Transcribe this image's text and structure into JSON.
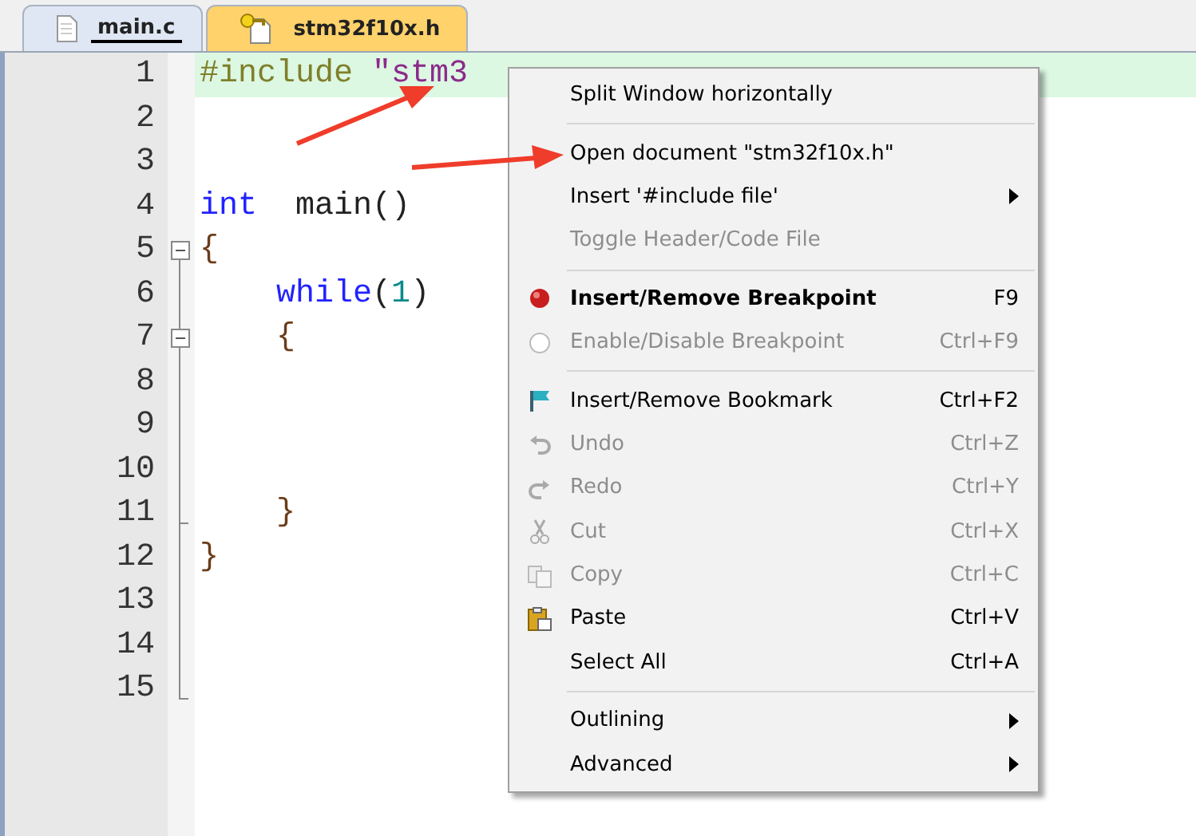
{
  "tabs": [
    {
      "label": "main.c",
      "selected": true
    },
    {
      "label": "stm32f10x.h",
      "selected": false
    }
  ],
  "editor": {
    "lines": [
      {
        "number": "1",
        "current": true,
        "collapsible": false,
        "fold_end": false,
        "tokens": [
          {
            "kind": "preproc",
            "text": "#include "
          },
          {
            "kind": "string",
            "text": "\"stm3"
          }
        ]
      },
      {
        "number": "2",
        "current": false,
        "collapsible": false,
        "fold_end": false
      },
      {
        "number": "3",
        "current": false,
        "collapsible": false,
        "fold_end": false
      },
      {
        "number": "4",
        "current": false,
        "collapsible": false,
        "fold_end": false,
        "tokens": [
          {
            "kind": "keyword",
            "text": "int"
          },
          {
            "kind": "plain",
            "text": "  main()"
          }
        ]
      },
      {
        "number": "5",
        "current": false,
        "collapsible": true,
        "fold_end": false,
        "tokens": [
          {
            "kind": "brace",
            "text": "{"
          }
        ]
      },
      {
        "number": "6",
        "current": false,
        "collapsible": false,
        "fold_end": false,
        "tokens": [
          {
            "kind": "keyword",
            "text": "    while"
          },
          {
            "kind": "plain",
            "text": "("
          },
          {
            "kind": "number",
            "text": "1"
          },
          {
            "kind": "plain",
            "text": ")"
          }
        ]
      },
      {
        "number": "7",
        "current": false,
        "collapsible": true,
        "fold_end": false,
        "tokens": [
          {
            "kind": "brace",
            "text": "    {"
          }
        ]
      },
      {
        "number": "8",
        "current": false,
        "collapsible": false,
        "fold_end": false
      },
      {
        "number": "9",
        "current": false,
        "collapsible": false,
        "fold_end": false
      },
      {
        "number": "10",
        "current": false,
        "collapsible": false,
        "fold_end": false
      },
      {
        "number": "11",
        "current": false,
        "collapsible": false,
        "fold_end": true,
        "tokens": [
          {
            "kind": "brace",
            "text": "    }"
          }
        ]
      },
      {
        "number": "12",
        "current": false,
        "collapsible": false,
        "fold_end": false,
        "tokens": [
          {
            "kind": "brace",
            "text": "}"
          }
        ]
      },
      {
        "number": "13",
        "current": false,
        "collapsible": false,
        "fold_end": false
      },
      {
        "number": "14",
        "current": false,
        "collapsible": false,
        "fold_end": false
      },
      {
        "number": "15",
        "current": false,
        "collapsible": false,
        "fold_end": true
      }
    ]
  },
  "context_menu": {
    "items": [
      {
        "kind": "item",
        "label": "Split Window horizontally",
        "disabled": false,
        "bold": false,
        "submenu": false
      },
      {
        "kind": "separator"
      },
      {
        "kind": "item",
        "label": "Open document \"stm32f10x.h\"",
        "disabled": false,
        "bold": false,
        "submenu": false
      },
      {
        "kind": "item",
        "label": "Insert '#include file'",
        "disabled": false,
        "bold": false,
        "submenu": true
      },
      {
        "kind": "item",
        "label": "Toggle Header/Code File",
        "disabled": true,
        "bold": false,
        "submenu": false
      },
      {
        "kind": "separator"
      },
      {
        "kind": "item",
        "label": "Insert/Remove Breakpoint",
        "shortcut": "F9",
        "disabled": false,
        "bold": true,
        "submenu": false
      },
      {
        "kind": "item",
        "label": "Enable/Disable Breakpoint",
        "shortcut": "Ctrl+F9",
        "disabled": true,
        "bold": false,
        "submenu": false
      },
      {
        "kind": "separator"
      },
      {
        "kind": "item",
        "label": "Insert/Remove Bookmark",
        "shortcut": "Ctrl+F2",
        "disabled": false,
        "bold": false,
        "submenu": false
      },
      {
        "kind": "item",
        "label": "Undo",
        "shortcut": "Ctrl+Z",
        "disabled": true,
        "bold": false,
        "submenu": false
      },
      {
        "kind": "item",
        "label": "Redo",
        "shortcut": "Ctrl+Y",
        "disabled": true,
        "bold": false,
        "submenu": false
      },
      {
        "kind": "item",
        "label": "Cut",
        "shortcut": "Ctrl+X",
        "disabled": true,
        "bold": false,
        "submenu": false
      },
      {
        "kind": "item",
        "label": "Copy",
        "shortcut": "Ctrl+C",
        "disabled": true,
        "bold": false,
        "submenu": false
      },
      {
        "kind": "item",
        "label": "Paste",
        "shortcut": "Ctrl+V",
        "disabled": false,
        "bold": false,
        "submenu": false
      },
      {
        "kind": "item",
        "label": "Select All",
        "shortcut": "Ctrl+A",
        "disabled": false,
        "bold": false,
        "submenu": false
      },
      {
        "kind": "separator"
      },
      {
        "kind": "item",
        "label": "Outlining",
        "disabled": false,
        "bold": false,
        "submenu": true
      },
      {
        "kind": "item",
        "label": "Advanced",
        "disabled": false,
        "bold": false,
        "submenu": true
      }
    ]
  }
}
